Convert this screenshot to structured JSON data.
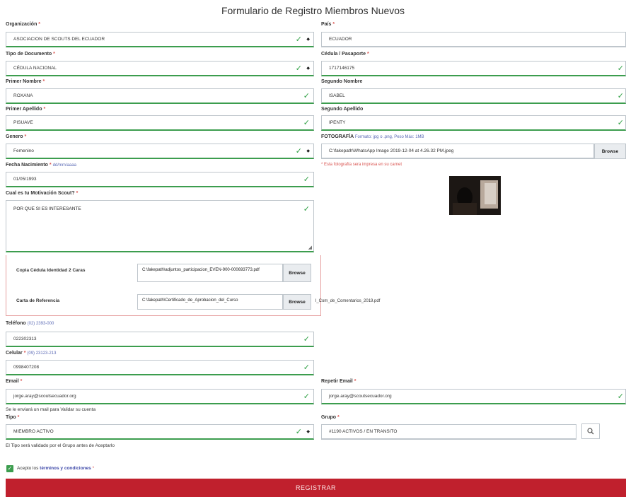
{
  "title": "Formulario de Registro Miembros Nuevos",
  "organizacion": {
    "label": "Organización",
    "value": "ASOCIACION DE SCOUTS DEL ECUADOR"
  },
  "pais": {
    "label": "País",
    "value": "ECUADOR"
  },
  "tipo_documento": {
    "label": "Tipo de Documento",
    "value": "CÉDULA NACIONAL"
  },
  "cedula": {
    "label": "Cédula / Pasaporte",
    "value": "1717146175"
  },
  "primer_nombre": {
    "label": "Primer Nombre",
    "value": "ROXANA"
  },
  "segundo_nombre": {
    "label": "Segundo Nombre",
    "value": "ISABEL"
  },
  "primer_apellido": {
    "label": "Primer Apellido",
    "value": "PISUAVE"
  },
  "segundo_apellido": {
    "label": "Segundo Apellido",
    "value": "IPENTY"
  },
  "genero": {
    "label": "Genero",
    "value": "Femenino"
  },
  "fotografia": {
    "label": "FOTOGRAFÍA",
    "hint": "Formato: jpg o .png, Peso Máx: 1MB",
    "value": "C:\\fakepath\\WhatsApp Image 2019-12-04 at 4.26.32 PM.jpeg",
    "browse": "Browse",
    "warning": "* Esta fotografía sera impresa en su carnet"
  },
  "fecha_nacimiento": {
    "label": "Fecha Nacimiento",
    "hint": "dd/mm/aaaa",
    "value": "01/05/1993"
  },
  "motivacion": {
    "label": "Cual es tu Motivación Scout?",
    "value": "POR QUE SI ES INTERESANTE"
  },
  "archivos": {
    "copia_cedula": {
      "label": "Copia Cédula Identidad 2 Caras",
      "value": "C:\\fakepath\\adjuntos_participacion_EVEN-900-000693773.pdf",
      "browse": "Browse"
    },
    "carta_referencia": {
      "label": "Carta de Referencia",
      "value": "C:\\fakepath\\Certificado_de_Aprobacion_del_Curso",
      "overflow": "l_Com_de_Comentarios_2019.pdf",
      "browse": "Browse"
    }
  },
  "telefono": {
    "label": "Teléfono",
    "hint": "(02) 2393-000",
    "value": "022302313"
  },
  "celular": {
    "label": "Celular",
    "hint": "(09) 23123-213",
    "value": "0998407208"
  },
  "email": {
    "label": "Email",
    "value": "jorge.aray@scoutsecuador.org",
    "note": "Se le enviará un mail para Validar su cuenta"
  },
  "repetir_email": {
    "label": "Repetir Email",
    "value": "jorge.aray@scoutsecuador.org"
  },
  "tipo": {
    "label": "Tipo",
    "value": "MIEMBRO ACTIVO",
    "note": "El Tipo será validado por el Grupo antes de Aceptarlo"
  },
  "grupo": {
    "label": "Grupo",
    "value": "#1190 ACTIVOS / EN TRANSITO"
  },
  "terminos": {
    "prefix": "Acepto los",
    "link": "términos y condiciones",
    "suffix": "*"
  },
  "submit_label": "REGISTRAR",
  "colors": {
    "valid": "#3c9d4e",
    "required": "#d9534f",
    "submit": "#c0202d",
    "hint": "#5b6ab5"
  }
}
